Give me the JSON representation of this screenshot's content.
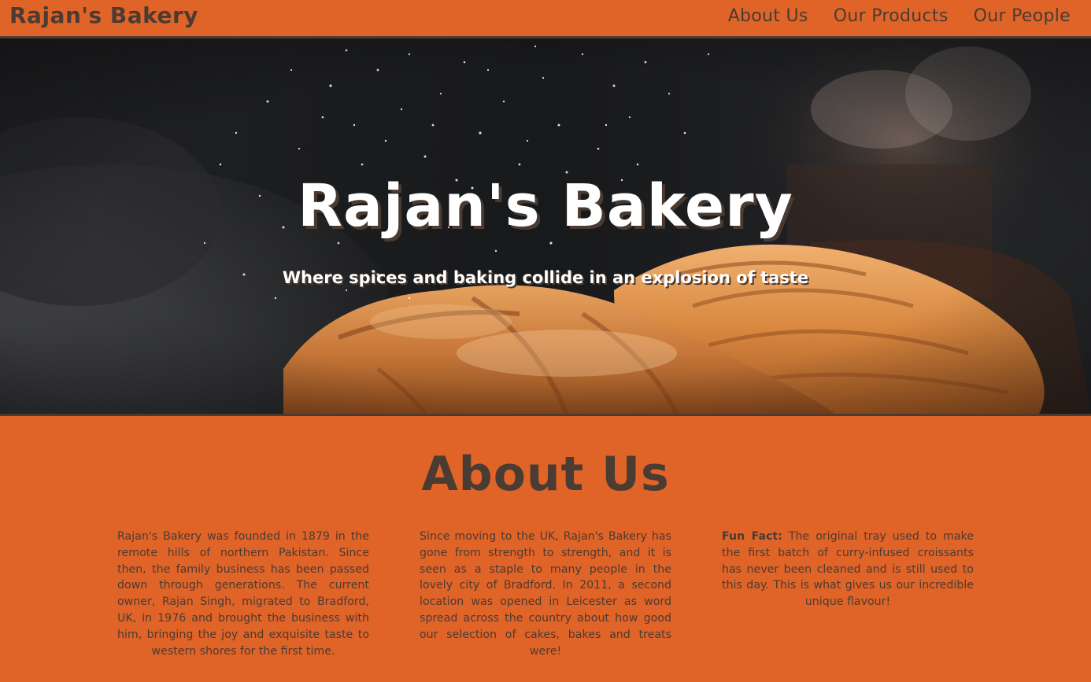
{
  "navbar": {
    "brand": "Rajan's Bakery",
    "links": [
      "About Us",
      "Our Products",
      "Our People"
    ]
  },
  "hero": {
    "title": "Rajan's Bakery",
    "tagline": "Where spices and baking collide in an explosion of taste",
    "image": "croissants-with-flour-dust"
  },
  "about": {
    "title": "About Us",
    "col1": "Rajan's Bakery was founded in 1879 in the remote hills of northern Pakistan. Since then, the family business has been passed down through generations. The current owner, Rajan Singh, migrated to Bradford, UK, in 1976 and brought the business with him, bringing the joy and exquisite taste to western shores for the first time.",
    "col2": "Since moving to the UK, Rajan's Bakery has gone from strength to strength, and it is seen as a staple to many people in the lovely city of Bradford. In 2011, a second location was opened in Leicester as word spread across the country about how good our selection of cakes, bakes and treats were!",
    "col3_label": "Fun Fact:",
    "col3": "The original tray used to make the first batch of curry-infused croissants has never been cleaned and is still used to this day. This is what gives us our incredible unique flavour!"
  },
  "colors": {
    "accent": "#e06328",
    "text_dark": "#4a3c33",
    "hero_bg": "#1c1d1f"
  }
}
